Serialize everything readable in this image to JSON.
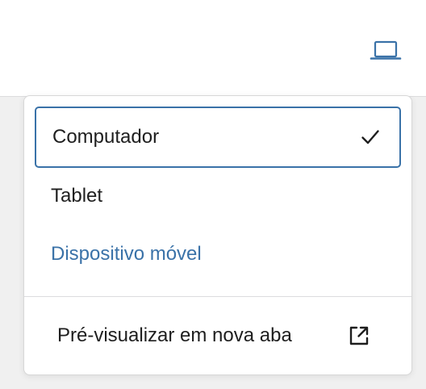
{
  "header": {
    "device_toggle_icon": "laptop-icon",
    "device_toggle_color": "#3a72a8"
  },
  "menu": {
    "items": [
      {
        "label": "Computador",
        "selected": true,
        "icon": "check-icon"
      },
      {
        "label": "Tablet",
        "selected": false
      },
      {
        "label": "Dispositivo móvel",
        "selected": false,
        "color": "#3a72a8"
      }
    ],
    "preview": {
      "label": "Pré-visualizar em nova aba",
      "icon": "external-link-icon"
    }
  },
  "colors": {
    "accent": "#3a72a8",
    "text": "#1e1e1e",
    "divider": "#dcdcde",
    "background": "#f0f0f0"
  }
}
